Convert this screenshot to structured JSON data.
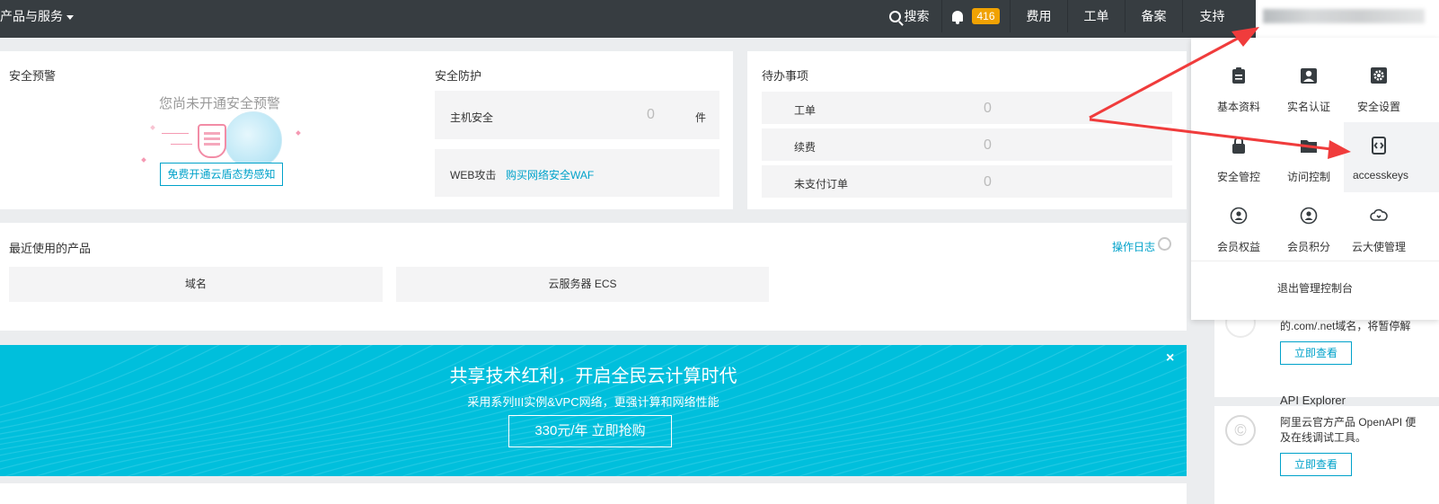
{
  "topbar": {
    "products_label": "产品与服务",
    "search_label": "搜索",
    "notifications_count": "416",
    "nav": [
      "费用",
      "工单",
      "备案",
      "支持"
    ]
  },
  "security_alert": {
    "title": "安全预警",
    "empty_text": "您尚未开通安全预警",
    "cta": "免费开通云盾态势感知"
  },
  "security_protect": {
    "title": "安全防护",
    "host_label": "主机安全",
    "host_count": "0",
    "host_unit": "件",
    "web_label": "WEB攻击",
    "waf_link": "购买网络安全WAF"
  },
  "todo": {
    "title": "待办事项",
    "items": [
      {
        "label": "工单",
        "count": "0"
      },
      {
        "label": "续费",
        "count": "0"
      },
      {
        "label": "未支付订单",
        "count": "0"
      }
    ]
  },
  "recent": {
    "title": "最近使用的产品",
    "log_link": "操作日志",
    "products": [
      "域名",
      "云服务器 ECS"
    ]
  },
  "banner": {
    "title": "共享技术红利，开启全民云计算时代",
    "subtitle": "采用系列III实例&VPC网络，更强计算和网络性能",
    "button": "330元/年 立即抢购",
    "close": "×"
  },
  "account_menu": {
    "items": [
      {
        "label": "基本资料",
        "icon": "clipboard-icon"
      },
      {
        "label": "实名认证",
        "icon": "id-card-icon"
      },
      {
        "label": "安全设置",
        "icon": "gear-icon"
      },
      {
        "label": "安全管控",
        "icon": "lock-icon"
      },
      {
        "label": "访问控制",
        "icon": "folder-icon"
      },
      {
        "label": "accesskeys",
        "icon": "code-icon"
      },
      {
        "label": "会员权益",
        "icon": "member-icon"
      },
      {
        "label": "会员积分",
        "icon": "points-icon"
      },
      {
        "label": "云大使管理",
        "icon": "cloud-icon"
      }
    ],
    "logout": "退出管理控制台"
  },
  "side_cards": {
    "domain_text": "的.com/.net域名，将暂停解",
    "domain_btn": "立即查看",
    "api_title": "API Explorer",
    "api_desc_1": "阿里云官方产品 OpenAPI 便",
    "api_desc_2": "及在线调试工具。",
    "api_btn": "立即查看"
  },
  "colors": {
    "topbar": "#373d41",
    "accent": "#00a2ca",
    "banner": "#00bfdc",
    "badge": "#f0a202",
    "arrow": "#f03c3c"
  }
}
